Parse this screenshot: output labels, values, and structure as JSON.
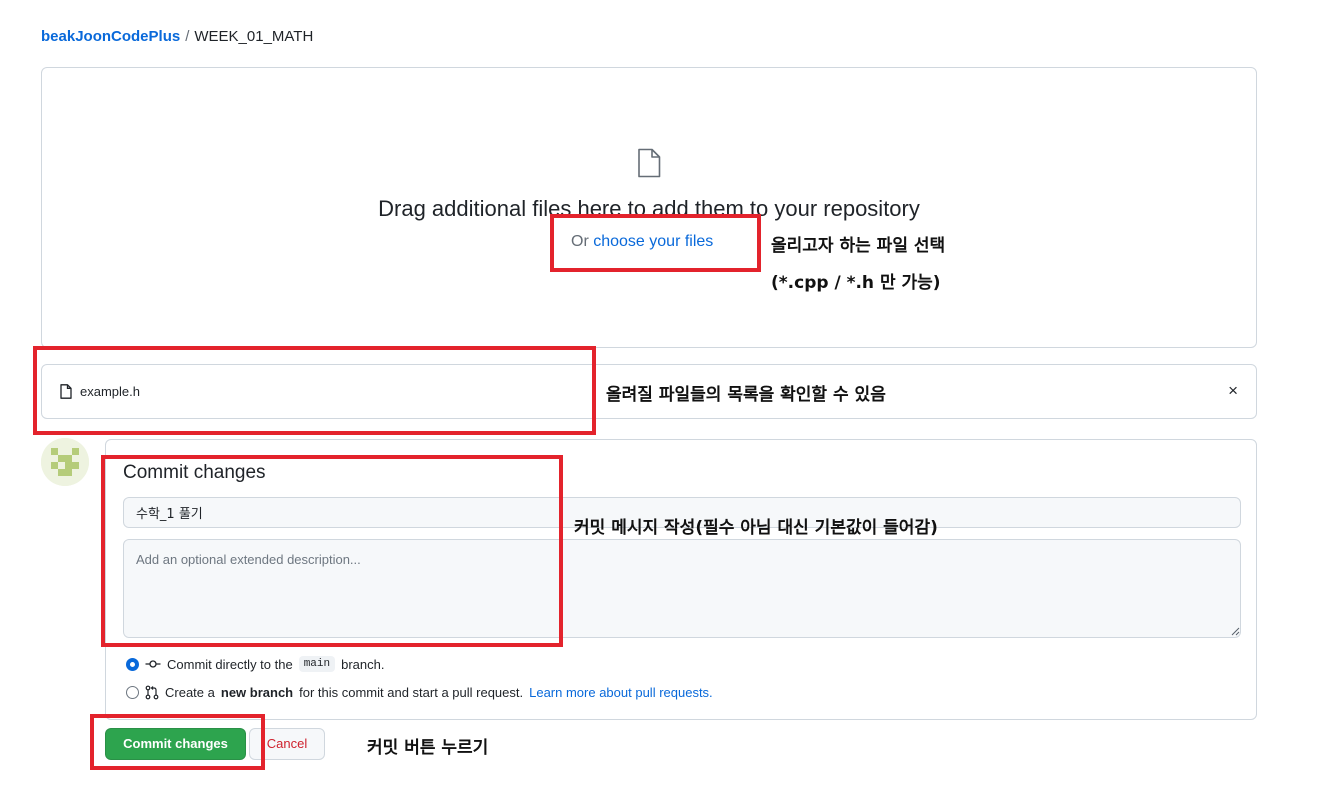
{
  "breadcrumb": {
    "owner": "beakJoonCodePlus",
    "separator": "/",
    "repo": "WEEK_01_MATH"
  },
  "dropzone": {
    "drag_text": "Drag additional files here to add them to your repository",
    "or_text": "Or",
    "choose_link": "choose your files",
    "icon": "file-icon"
  },
  "file_list": {
    "items": [
      {
        "name": "example.h",
        "icon": "file-icon"
      }
    ],
    "remove_label": "×"
  },
  "commit": {
    "title": "Commit changes",
    "message_value": "수학_1 풀기",
    "description_placeholder": "Add an optional extended description...",
    "option_direct": {
      "prefix": "Commit directly to the",
      "branch": "main",
      "suffix": "branch.",
      "icon": "git-commit-icon",
      "selected": true
    },
    "option_pr": {
      "prefix": "Create a",
      "bold": "new branch",
      "middle": "for this commit and start a pull request.",
      "link": "Learn more about pull requests.",
      "icon": "git-pull-request-icon",
      "selected": false
    },
    "commit_button": "Commit changes",
    "cancel_button": "Cancel"
  },
  "annotations": {
    "choose_file_line1": "올리고자 하는 파일 선택",
    "choose_file_line2": "(*.cpp / *.h 만 가능)",
    "file_list_note": "올려질 파일들의 목록을 확인할 수 있음",
    "commit_message_note": "커밋 메시지 작성(필수 아님 대신 기본값이 들어감)",
    "commit_button_note": "커밋 버튼 누르기"
  },
  "colors": {
    "highlight": "#e3232c",
    "link": "#0969da",
    "primary_button": "#2da44e",
    "danger_text": "#cf222e",
    "border": "#d0d7de"
  }
}
